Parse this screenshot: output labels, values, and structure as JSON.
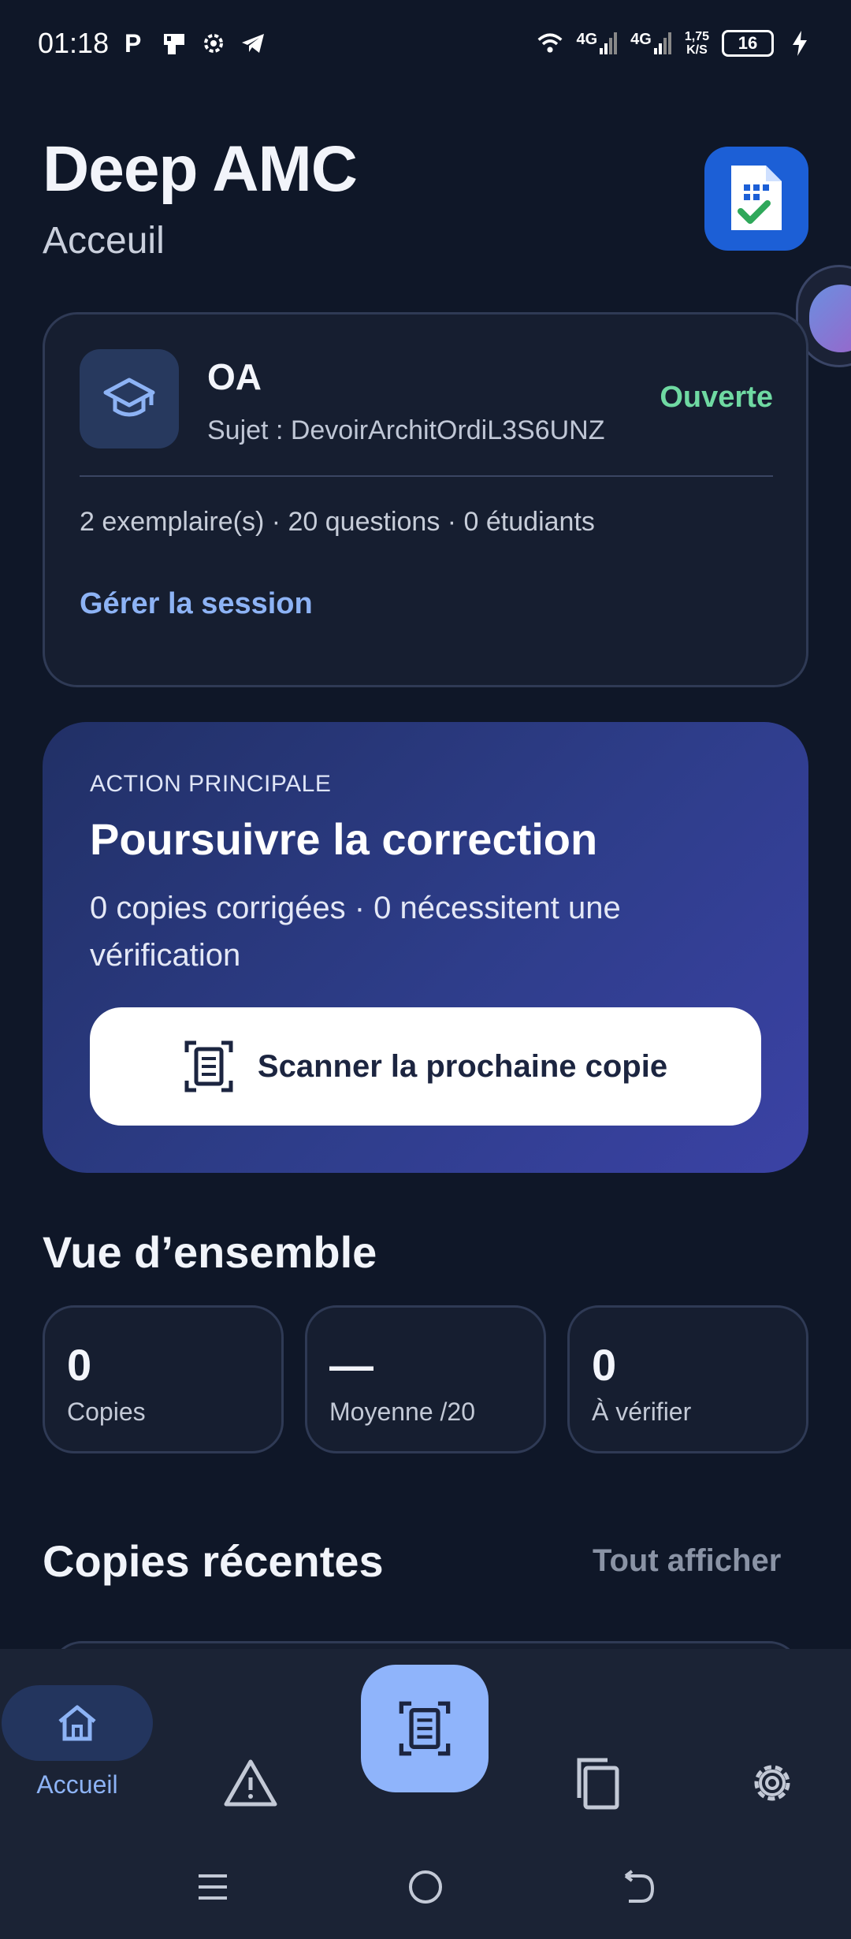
{
  "status_bar": {
    "time": "01:18",
    "net_1": "4G",
    "net_2": "4G",
    "speed_value": "1,75",
    "speed_unit": "K/S",
    "battery": "16",
    "icons": [
      "parking-icon",
      "notification-icon",
      "settings-cog-icon",
      "telegram-icon",
      "wifi-icon",
      "signal-icon",
      "signal-icon",
      "battery-icon",
      "charging-icon"
    ]
  },
  "header": {
    "title": "Deep AMC",
    "subtitle": "Acceuil",
    "logo_icon": "document-check-icon",
    "logo_color": "#1c5fd6"
  },
  "session": {
    "name": "OA",
    "subject": "Sujet : DevoirArchitOrdiL3S6UNZ",
    "status": "Ouverte",
    "stats": "2 exemplaire(s) · 20 questions · 0 étudiants",
    "manage_link": "Gérer la session",
    "icon": "graduation-cap-icon",
    "status_color": "#6fd9a2"
  },
  "action": {
    "kicker": "ACTION PRINCIPALE",
    "title": "Poursuivre la correction",
    "description": "0 copies corrigées · 0 nécessitent une vérification",
    "button_label": "Scanner la prochaine copie",
    "button_icon": "document-scan-icon"
  },
  "overview": {
    "title": "Vue d’ensemble",
    "stats": [
      {
        "value": "0",
        "label": "Copies"
      },
      {
        "value": "—",
        "label": "Moyenne /20"
      },
      {
        "value": "0",
        "label": "À vérifier"
      }
    ]
  },
  "recent": {
    "title": "Copies récentes",
    "link": "Tout afficher"
  },
  "bottom_nav": {
    "home_label": "Accueil",
    "items": [
      "home-icon",
      "warning-icon",
      "scan-icon",
      "copies-icon",
      "settings-icon"
    ],
    "accent": "#8fb4fb"
  },
  "system_nav": [
    "menu-icon",
    "home-circle-icon",
    "back-icon"
  ]
}
